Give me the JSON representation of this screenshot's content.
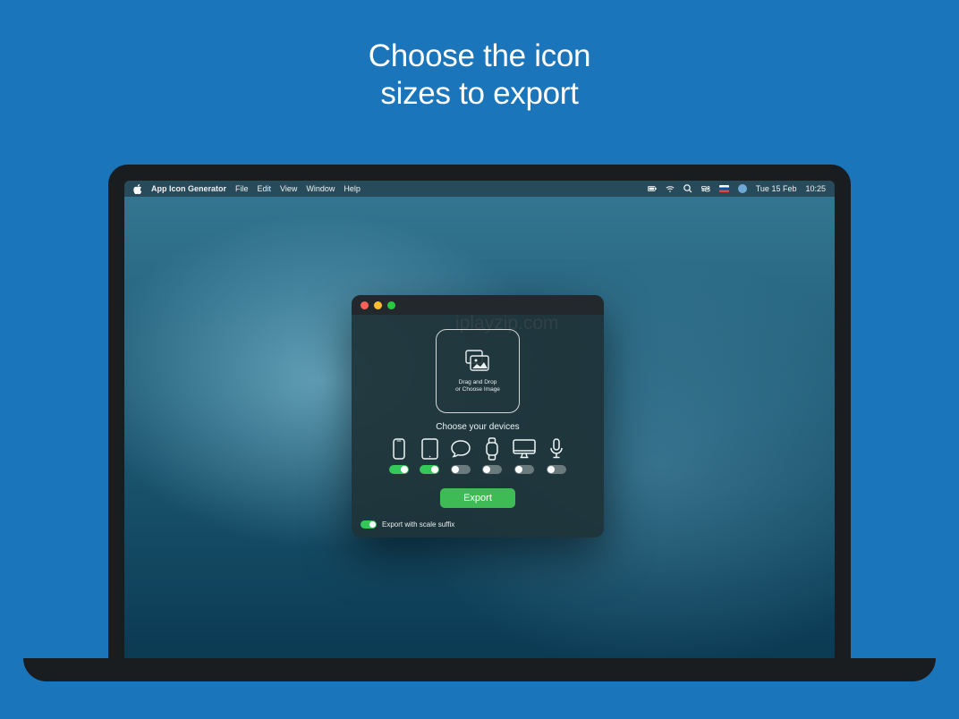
{
  "headline_line1": "Choose the icon",
  "headline_line2": "sizes to export",
  "watermark": "iplayzip.com",
  "menubar": {
    "app_name": "App Icon Generator",
    "menus": [
      "File",
      "Edit",
      "View",
      "Window",
      "Help"
    ],
    "date": "Tue 15 Feb",
    "time": "10:25"
  },
  "window": {
    "drop_text_line1": "Drag and Drop",
    "drop_text_line2": "or Choose Image",
    "choose_label": "Choose your devices",
    "devices": [
      {
        "name": "iphone",
        "on": true
      },
      {
        "name": "ipad",
        "on": true
      },
      {
        "name": "message",
        "on": false
      },
      {
        "name": "watch",
        "on": false
      },
      {
        "name": "mac",
        "on": false
      },
      {
        "name": "carplay",
        "on": false
      }
    ],
    "export_label": "Export",
    "suffix_label": "Export with scale suffix",
    "suffix_on": true
  }
}
